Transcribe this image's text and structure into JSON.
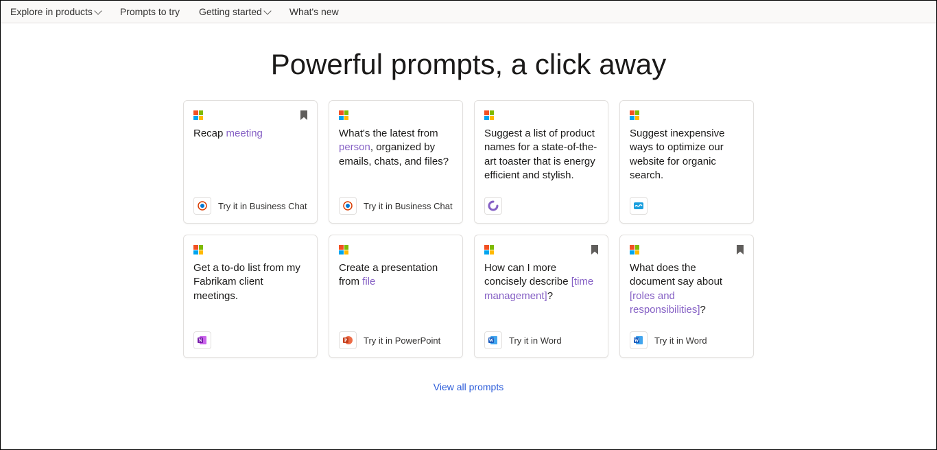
{
  "nav": {
    "explore": "Explore in products",
    "prompts": "Prompts to try",
    "getting_started": "Getting started",
    "whats_new": "What's new"
  },
  "hero": "Powerful prompts, a click away",
  "cards": [
    {
      "bookmarked": true,
      "segments": [
        {
          "t": "Recap "
        },
        {
          "t": "meeting",
          "hl": true
        }
      ],
      "app_icon": "copilot",
      "try_label": "Try it in Business Chat"
    },
    {
      "bookmarked": false,
      "segments": [
        {
          "t": "What's the latest from "
        },
        {
          "t": "person",
          "hl": true
        },
        {
          "t": ", organized by emails, chats, and files?"
        }
      ],
      "app_icon": "copilot",
      "try_label": "Try it in Business Chat"
    },
    {
      "bookmarked": false,
      "segments": [
        {
          "t": "Suggest a list of product names for a state-of-the-art toaster that is energy efficient and stylish."
        }
      ],
      "app_icon": "loop",
      "try_label": ""
    },
    {
      "bookmarked": false,
      "segments": [
        {
          "t": "Suggest inexpensive ways to optimize our website for organic search."
        }
      ],
      "app_icon": "whiteboard",
      "try_label": ""
    },
    {
      "bookmarked": false,
      "segments": [
        {
          "t": "Get a to-do list from my Fabrikam client meetings."
        }
      ],
      "app_icon": "onenote",
      "try_label": ""
    },
    {
      "bookmarked": false,
      "segments": [
        {
          "t": "Create a presentation from "
        },
        {
          "t": "file",
          "hl": true
        }
      ],
      "app_icon": "powerpoint",
      "try_label": "Try it in PowerPoint"
    },
    {
      "bookmarked": true,
      "segments": [
        {
          "t": "How can I more concisely describe "
        },
        {
          "t": "[time management]",
          "hl": true
        },
        {
          "t": "?"
        }
      ],
      "app_icon": "word",
      "try_label": "Try it in Word"
    },
    {
      "bookmarked": true,
      "segments": [
        {
          "t": "What does the document say about "
        },
        {
          "t": "[roles and responsibilities]",
          "hl": true
        },
        {
          "t": "?"
        }
      ],
      "app_icon": "word",
      "try_label": "Try it in Word"
    }
  ],
  "footer": {
    "view_all": "View all prompts"
  },
  "icon_svg": {
    "copilot": "<svg width='16' height='16' viewBox='0 0 16 16'><circle cx='8' cy='8' r='6' fill='none' stroke='#d83b01' stroke-width='1.5'/><circle cx='8' cy='8' r='3' fill='#0078d4'/></svg>",
    "loop": "<svg width='16' height='16' viewBox='0 0 16 16'><path d='M8 2a6 6 0 1 0 6 6' fill='none' stroke='#8661c5' stroke-width='3' stroke-linecap='round'/></svg>",
    "whiteboard": "<svg width='16' height='16' viewBox='0 0 16 16'><rect x='1' y='3' width='14' height='10' rx='2' fill='#1a9fde'/><path d='M3 9c2-4 4 2 6-1s3-1 4 0' stroke='#fff' stroke-width='1.3' fill='none'/></svg>",
    "onenote": "<svg width='16' height='16' viewBox='0 0 16 16'><rect x='4' y='2' width='10' height='12' rx='1' fill='#ca64ea'/><rect x='1' y='4' width='8' height='8' rx='1' fill='#7719aa'/><text x='5' y='10.5' font-size='7' fill='#fff' text-anchor='middle' font-family='Segoe UI' font-weight='600'>N</text></svg>",
    "powerpoint": "<svg width='16' height='16' viewBox='0 0 16 16'><circle cx='9' cy='8' r='6' fill='#ed6c47'/><rect x='1' y='4' width='8' height='8' rx='1' fill='#c43e1c'/><text x='5' y='10.5' font-size='7' fill='#fff' text-anchor='middle' font-family='Segoe UI' font-weight='600'>P</text></svg>",
    "word": "<svg width='16' height='16' viewBox='0 0 16 16'><rect x='4' y='2' width='10' height='12' rx='1' fill='#41a5ee'/><rect x='1' y='4' width='8' height='8' rx='1' fill='#185abd'/><text x='5' y='10.5' font-size='7' fill='#fff' text-anchor='middle' font-family='Segoe UI' font-weight='600'>W</text></svg>"
  }
}
